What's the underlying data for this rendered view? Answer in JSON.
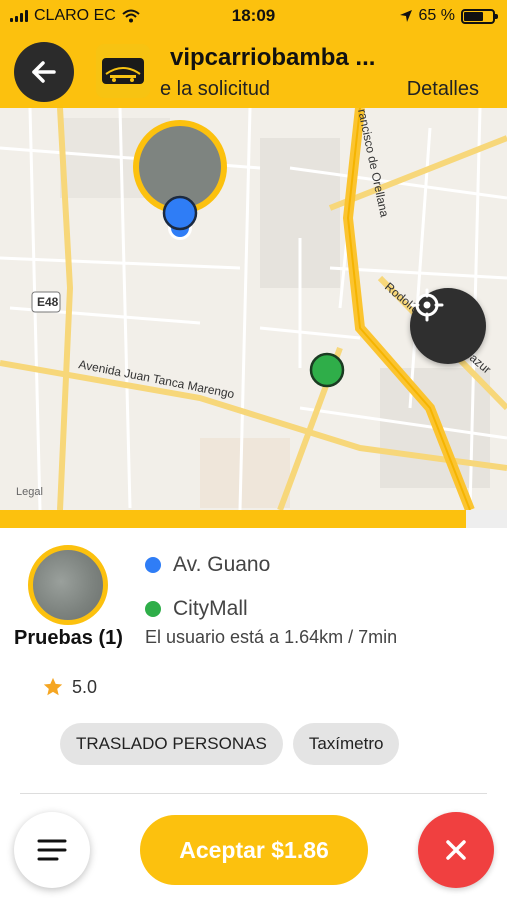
{
  "status_bar": {
    "carrier": "CLARO EC",
    "time": "18:09",
    "battery": "65 %",
    "battery_level": 0.65
  },
  "header": {
    "title": "vipcarriobamba ...",
    "subtitle": "e la solicitud",
    "details_label": "Detalles",
    "back_icon": "arrow-left-icon",
    "logo_icon": "company-logo"
  },
  "map": {
    "streets": {
      "highway": "E48",
      "avenida_juan_tanca": "Avenida Juan Tanca Marengo",
      "francisco_orellana": "rancisco de Orellana",
      "rodolfo_baquerizo": "Rodolfo Baquerizo Nazur"
    },
    "legal": "Legal",
    "locate_icon": "crosshair-icon"
  },
  "progress": {
    "value": 0.92,
    "color": "#fcc10e"
  },
  "request": {
    "user_name": "Pruebas (1)",
    "rating": "5.0",
    "pickup": "Av. Guano",
    "destination": "CityMall",
    "distance_text": "El usuario está a 1.64km / 7min",
    "tags": [
      "TRASLADO PERSONAS",
      "Taxímetro"
    ]
  },
  "actions": {
    "accept_label": "Aceptar $1.86",
    "menu_icon": "menu-lines-icon",
    "cancel_icon": "close-icon"
  },
  "colors": {
    "accent": "#fcc10e",
    "pickup": "#2f7df6",
    "destination": "#2fae49",
    "cancel": "#f04040"
  }
}
